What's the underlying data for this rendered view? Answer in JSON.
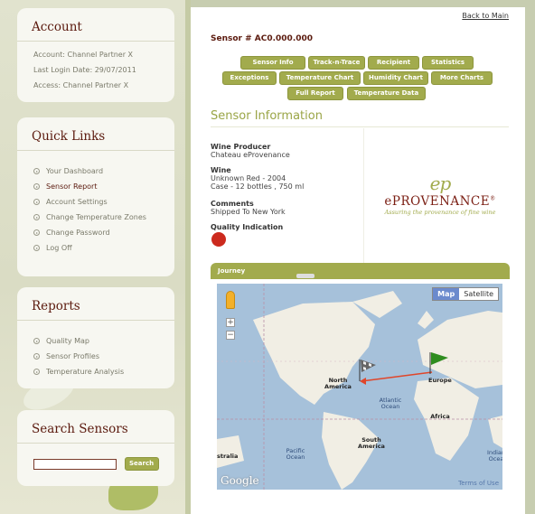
{
  "account": {
    "title": "Account",
    "account_line": "Account: Channel Partner X",
    "login_line": "Last Login Date: 29/07/2011",
    "access_line": "Access: Channel Partner X"
  },
  "quick_links": {
    "title": "Quick Links",
    "items": [
      "Your Dashboard",
      "Sensor Report",
      "Account Settings",
      "Change Temperature Zones",
      "Change Password",
      "Log Off"
    ]
  },
  "reports": {
    "title": "Reports",
    "items": [
      "Quality Map",
      "Sensor Profiles",
      "Temperature Analysis"
    ]
  },
  "search": {
    "title": "Search Sensors",
    "input_value": "",
    "button_label": "Search"
  },
  "main": {
    "back_link": "Back to Main",
    "sensor_title": "Sensor # AC0.000.000",
    "tabs": [
      "Sensor Info",
      "Track-n-Trace",
      "Recipient",
      "Statistics",
      "Exceptions",
      "Temperature Chart",
      "Humidity Chart",
      "More Charts",
      "Full Report",
      "Temperature Data"
    ],
    "section_title": "Sensor Information",
    "producer_label": "Wine Producer",
    "producer_value": "Chateau eProvenance",
    "wine_label": "Wine",
    "wine_value_1": "Unknown Red - 2004",
    "wine_value_2": "Case - 12 bottles , 750 ml",
    "comments_label": "Comments",
    "comments_value": "Shipped To New York",
    "quality_label": "Quality Indication",
    "quality_color": "#cc2a1e",
    "logo": {
      "mark": "ep",
      "name": "ePROVENANCE",
      "registered": "®",
      "tagline": "Assuring the provenance of fine wine"
    }
  },
  "journey": {
    "title": "Journey",
    "map_type_map": "Map",
    "map_type_satellite": "Satellite",
    "zoom_in": "+",
    "zoom_out": "−",
    "labels": {
      "north_america": "North America",
      "europe": "Europe",
      "atlantic": "Atlantic Ocean",
      "africa": "Africa",
      "south_america": "South America",
      "pacific": "Pacific Ocean",
      "indian": "Indian Ocea",
      "australia": "stralia"
    },
    "google": "Google",
    "terms": "Terms of Use"
  },
  "colors": {
    "accent": "#a2ab4d",
    "title": "#5b1a0e",
    "quality": "#cc2a1e"
  }
}
